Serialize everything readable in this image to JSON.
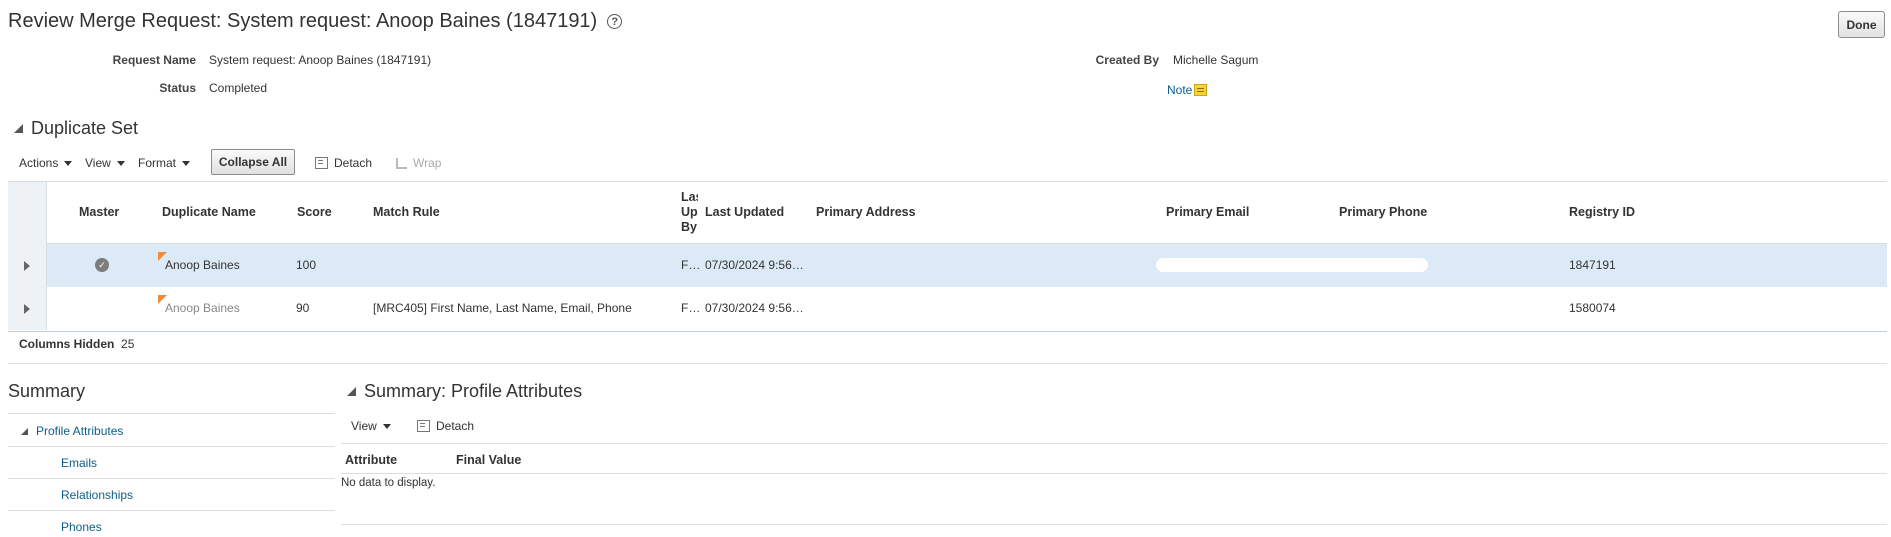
{
  "header": {
    "title": "Review Merge Request: System request: Anoop Baines (1847191)",
    "help_glyph": "?",
    "done_label": "Done"
  },
  "request": {
    "name_label": "Request Name",
    "name_value": "System request: Anoop Baines (1847191)",
    "status_label": "Status",
    "status_value": "Completed",
    "created_by_label": "Created By",
    "created_by_value": "Michelle Sagum",
    "note_label": "Note"
  },
  "duplicate_set": {
    "title": "Duplicate Set",
    "toolbar": {
      "actions": "Actions",
      "view": "View",
      "format": "Format",
      "collapse_all": "Collapse All",
      "detach": "Detach",
      "wrap": "Wrap"
    },
    "columns": {
      "master": "Master",
      "duplicate_name": "Duplicate Name",
      "score": "Score",
      "match_rule": "Match Rule",
      "last_updated_by_l1": "Las",
      "last_updated_by_l2": "Upd",
      "last_updated_by_l3": "By",
      "last_updated": "Last Updated",
      "primary_address": "Primary Address",
      "primary_email": "Primary Email",
      "primary_phone": "Primary Phone",
      "registry_id": "Registry ID"
    },
    "rows": [
      {
        "master": true,
        "name": "Anoop Baines",
        "score": "100",
        "match_rule": "",
        "last_updated_by": "F…",
        "last_updated": "07/30/2024 9:56…",
        "primary_address": "",
        "primary_email": "",
        "primary_phone": "",
        "registry_id": "1847191"
      },
      {
        "master": false,
        "name": "Anoop Baines",
        "score": "90",
        "match_rule": "[MRC405] First Name, Last Name, Email, Phone",
        "last_updated_by": "F…",
        "last_updated": "07/30/2024 9:56…",
        "primary_address": "",
        "primary_email": "",
        "primary_phone": "",
        "registry_id": "1580074"
      }
    ],
    "columns_hidden_label": "Columns Hidden",
    "columns_hidden_count": "25"
  },
  "summary": {
    "title": "Summary",
    "tree": {
      "parent": "Profile Attributes",
      "children": [
        "Emails",
        "Relationships",
        "Phones"
      ]
    }
  },
  "profile_attributes": {
    "title": "Summary: Profile Attributes",
    "toolbar": {
      "view": "View",
      "detach": "Detach"
    },
    "columns": {
      "attribute": "Attribute",
      "final_value": "Final Value"
    },
    "empty_text": "No data to display."
  },
  "colors": {
    "link": "#0b5e8c",
    "selected_row": "#dbeaf6",
    "flag": "#f08a3c",
    "note_icon": "#f5d33b"
  },
  "icons": [
    "help-icon",
    "note-icon",
    "check-circle-icon",
    "detach-icon",
    "wrap-icon",
    "flag-icon",
    "expand-icon"
  ]
}
